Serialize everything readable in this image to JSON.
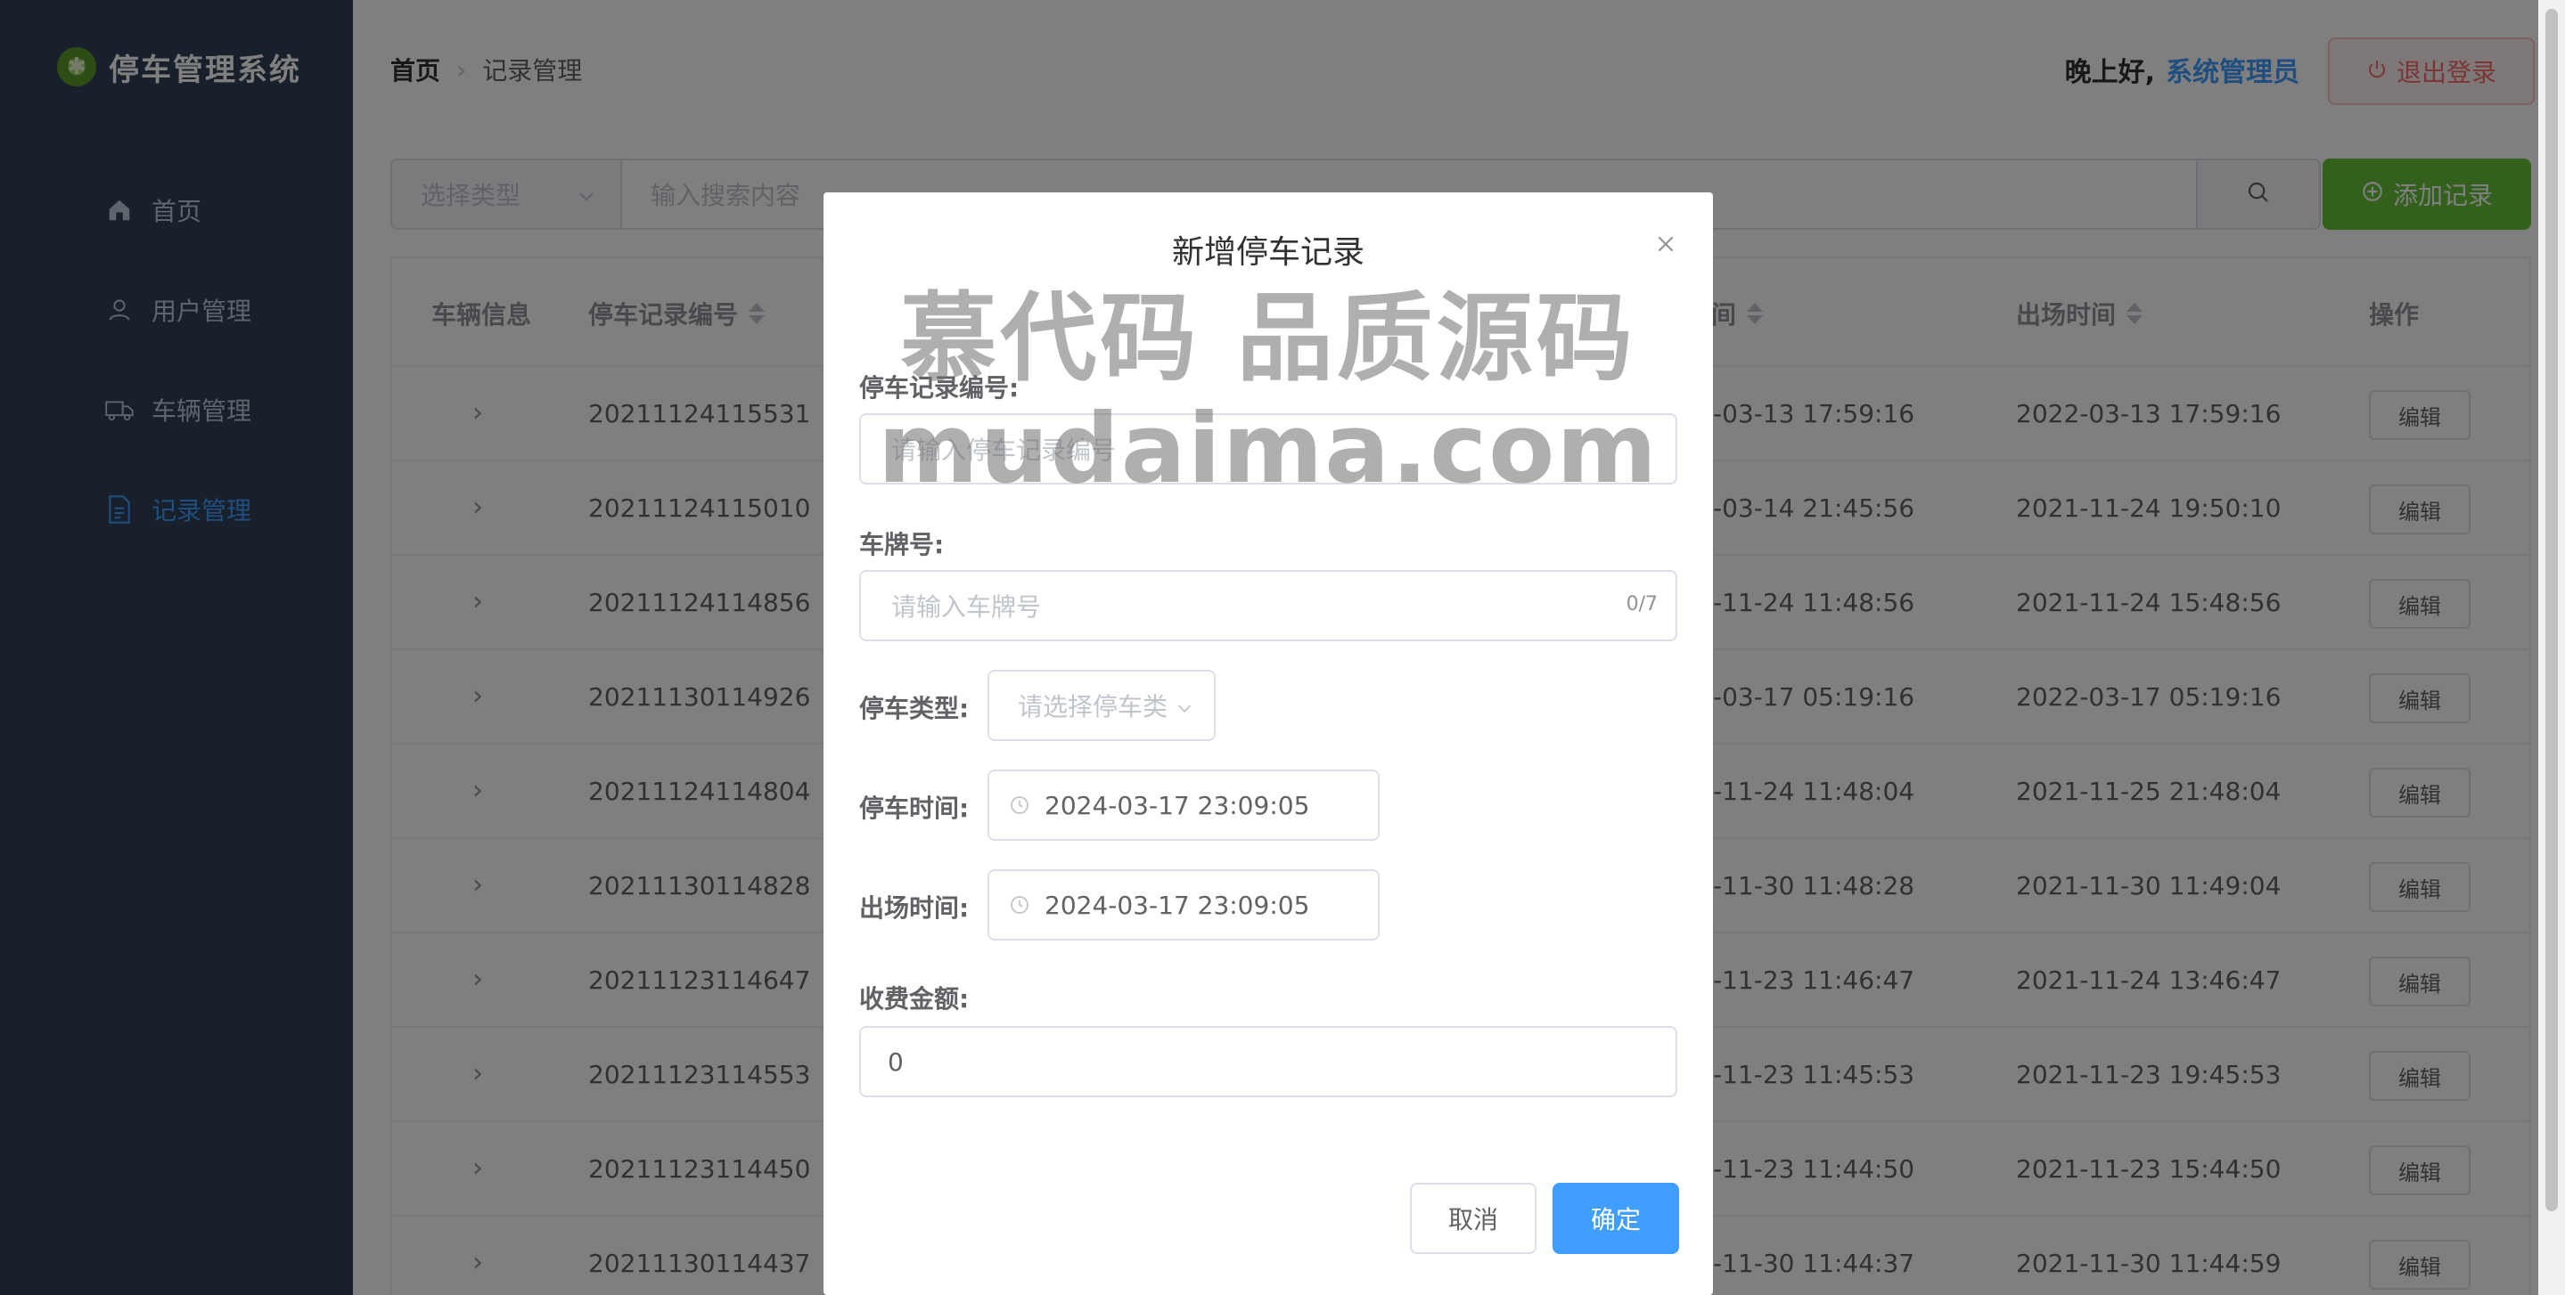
{
  "app": {
    "title": "停车管理系统"
  },
  "sidebar": {
    "items": [
      {
        "label": "首页",
        "icon": "home-icon"
      },
      {
        "label": "用户管理",
        "icon": "user-icon"
      },
      {
        "label": "车辆管理",
        "icon": "truck-icon"
      },
      {
        "label": "记录管理",
        "icon": "document-icon",
        "active": true
      }
    ]
  },
  "header": {
    "breadcrumb": [
      "首页",
      "记录管理"
    ],
    "greeting": "晚上好,",
    "user": "系统管理员",
    "logout_label": "退出登录"
  },
  "search": {
    "type_placeholder": "选择类型",
    "input_placeholder": "输入搜索内容",
    "add_label": "添加记录"
  },
  "table": {
    "columns": [
      "车辆信息",
      "停车记录编号",
      "间",
      "出场时间",
      "操作"
    ],
    "edit_label": "编辑",
    "rows": [
      {
        "id": "20211124115531",
        "in": "-03-13 17:59:16",
        "out": "2022-03-13 17:59:16"
      },
      {
        "id": "20211124115010",
        "in": "-03-14 21:45:56",
        "out": "2021-11-24 19:50:10"
      },
      {
        "id": "20211124114856",
        "in": "-11-24 11:48:56",
        "out": "2021-11-24 15:48:56"
      },
      {
        "id": "20211130114926",
        "in": "-03-17 05:19:16",
        "out": "2022-03-17 05:19:16"
      },
      {
        "id": "20211124114804",
        "in": "-11-24 11:48:04",
        "out": "2021-11-25 21:48:04"
      },
      {
        "id": "20211130114828",
        "in": "-11-30 11:48:28",
        "out": "2021-11-30 11:49:04"
      },
      {
        "id": "20211123114647",
        "in": "-11-23 11:46:47",
        "out": "2021-11-24 13:46:47"
      },
      {
        "id": "20211123114553",
        "in": "-11-23 11:45:53",
        "out": "2021-11-23 19:45:53"
      },
      {
        "id": "20211123114450",
        "in": "-11-23 11:44:50",
        "out": "2021-11-23 15:44:50"
      },
      {
        "id": "20211130114437",
        "in": "-11-30 11:44:37",
        "out": "2021-11-30 11:44:59"
      }
    ]
  },
  "dialog": {
    "title": "新增停车记录",
    "watermark_line1": "慕代码 品质源码",
    "watermark_line2": "mudaima.com",
    "fields": {
      "record_no_label": "停车记录编号:",
      "record_no_placeholder": "请输入停车记录编号",
      "plate_label": "车牌号:",
      "plate_placeholder": "请输入车牌号",
      "plate_counter": "0/7",
      "type_label": "停车类型:",
      "type_placeholder": "请选择停车类",
      "time_in_label": "停车时间:",
      "time_in_value": "2024-03-17 23:09:05",
      "time_out_label": "出场时间:",
      "time_out_value": "2024-03-17 23:09:05",
      "fee_label": "收费金额:",
      "fee_value": "0"
    },
    "cancel_label": "取消",
    "ok_label": "确定"
  },
  "colors": {
    "sidebar_bg": "#304156",
    "primary": "#409eff",
    "success": "#67c23a",
    "danger": "#f56c6c"
  }
}
